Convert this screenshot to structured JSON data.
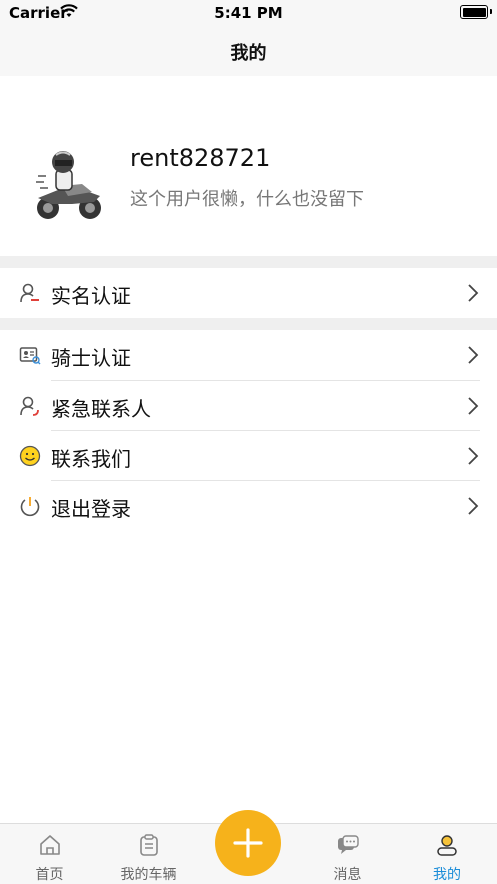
{
  "status_bar": {
    "carrier": "Carrier",
    "time": "5:41 PM"
  },
  "nav": {
    "title": "我的"
  },
  "profile": {
    "username": "rent828721",
    "bio": "这个用户很懒，什么也没留下"
  },
  "menu": {
    "group1": [
      {
        "label": "实名认证",
        "icon": "id-user-icon"
      }
    ],
    "group2": [
      {
        "label": "骑士认证",
        "icon": "rider-card-icon"
      },
      {
        "label": "紧急联系人",
        "icon": "emergency-contact-icon"
      },
      {
        "label": "联系我们",
        "icon": "smiley-icon"
      },
      {
        "label": "退出登录",
        "icon": "power-icon"
      }
    ]
  },
  "tabbar": {
    "tabs": [
      {
        "label": "首页",
        "icon": "home-icon"
      },
      {
        "label": "我的车辆",
        "icon": "clipboard-icon"
      },
      {
        "label": "消息",
        "icon": "message-icon"
      },
      {
        "label": "我的",
        "icon": "user-icon",
        "active": true
      }
    ],
    "fab_icon": "plus-icon"
  },
  "colors": {
    "accent": "#1a8cd8",
    "fab": "#f6b21b",
    "separator": "#efefef"
  }
}
